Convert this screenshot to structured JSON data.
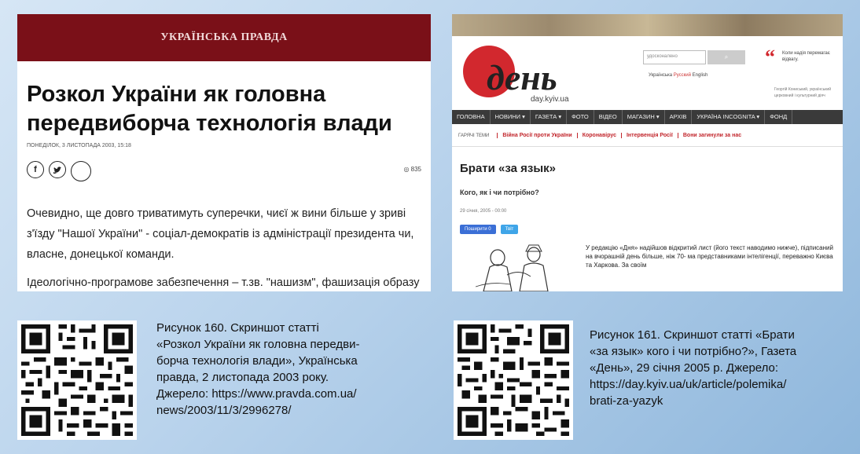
{
  "left_screenshot": {
    "site_name": "УКРАЇНСЬКА ПРАВДА",
    "title_lines": [
      "Розкол України як головна",
      "передвиборча технологія влади"
    ],
    "date": "ПОНЕДІЛОК, 3 ЛИСТОПАДА 2003, 15:18",
    "views": "835",
    "paragraph1_lines": [
      "Очевидно, ще довго триватимуть суперечки, чиєї ж вини більше у зриві",
      "з'їзду \"Нашої України\" - соціал-демократів із адміністрації президента чи,",
      "власне, донецької команди."
    ],
    "paragraph2": "Ідеологічно-програмове забезпечення – т.зв. \"нашизм\", фашизація образу"
  },
  "right_screenshot": {
    "logo_text": "день",
    "logo_url": "day.kyiv.ua",
    "search_placeholder": "удосконалено",
    "languages": [
      "Українська",
      "Русский",
      "English"
    ],
    "quote": "Коли надія перемагає відвагу.",
    "quote_source": "Георгій Кониський, український церковний і культурний діяч",
    "nav_items": [
      "ГОЛОВНА",
      "НОВИНИ ▾",
      "ГАЗЕТА ▾",
      "ФОТО",
      "ВІДЕО",
      "МАГАЗИН ▾",
      "АРХІВ",
      "УКРАЇНА INCOGNITA ▾",
      "ФОНД"
    ],
    "hot_topics_label": "ГАРЯЧІ ТЕМИ",
    "hot_topics": [
      "Війна Росії проти України",
      "Коронавірус",
      "Інтервенція Росії",
      "Вони загинули за нас"
    ],
    "title": "Брати «за язык»",
    "subtitle": "Кого, як і чи потрібно?",
    "date": "29 січня, 2005 - 00:00",
    "share_buttons": [
      "Поширити 0",
      "Твіт"
    ],
    "body": "У редакцію «Дня» надійшов відкритий лист (його текст наводимо нижче), підписаний на вчорашній день більше, ніж 70- ма представниками інтелігенції, переважно Києва та Харкова. За своїм"
  },
  "caption1_lines": [
    "Рисунок 160. Скриншот статті",
    "«Розкол України як головна передви-",
    "борча технологія влади», Українська",
    "правда, 2 листопада 2003 року.",
    "Джерело: https://www.pravda.com.ua/",
    "news/2003/11/3/2996278/"
  ],
  "caption2_lines": [
    "Рисунок 161. Скриншот статті «Брати",
    "«за язык» кого і чи потрібно?», Газета",
    "«День», 29 січня 2005 р. Джерело:",
    "https://day.kyiv.ua/uk/article/polemika/",
    "brati-za-yazyk"
  ]
}
